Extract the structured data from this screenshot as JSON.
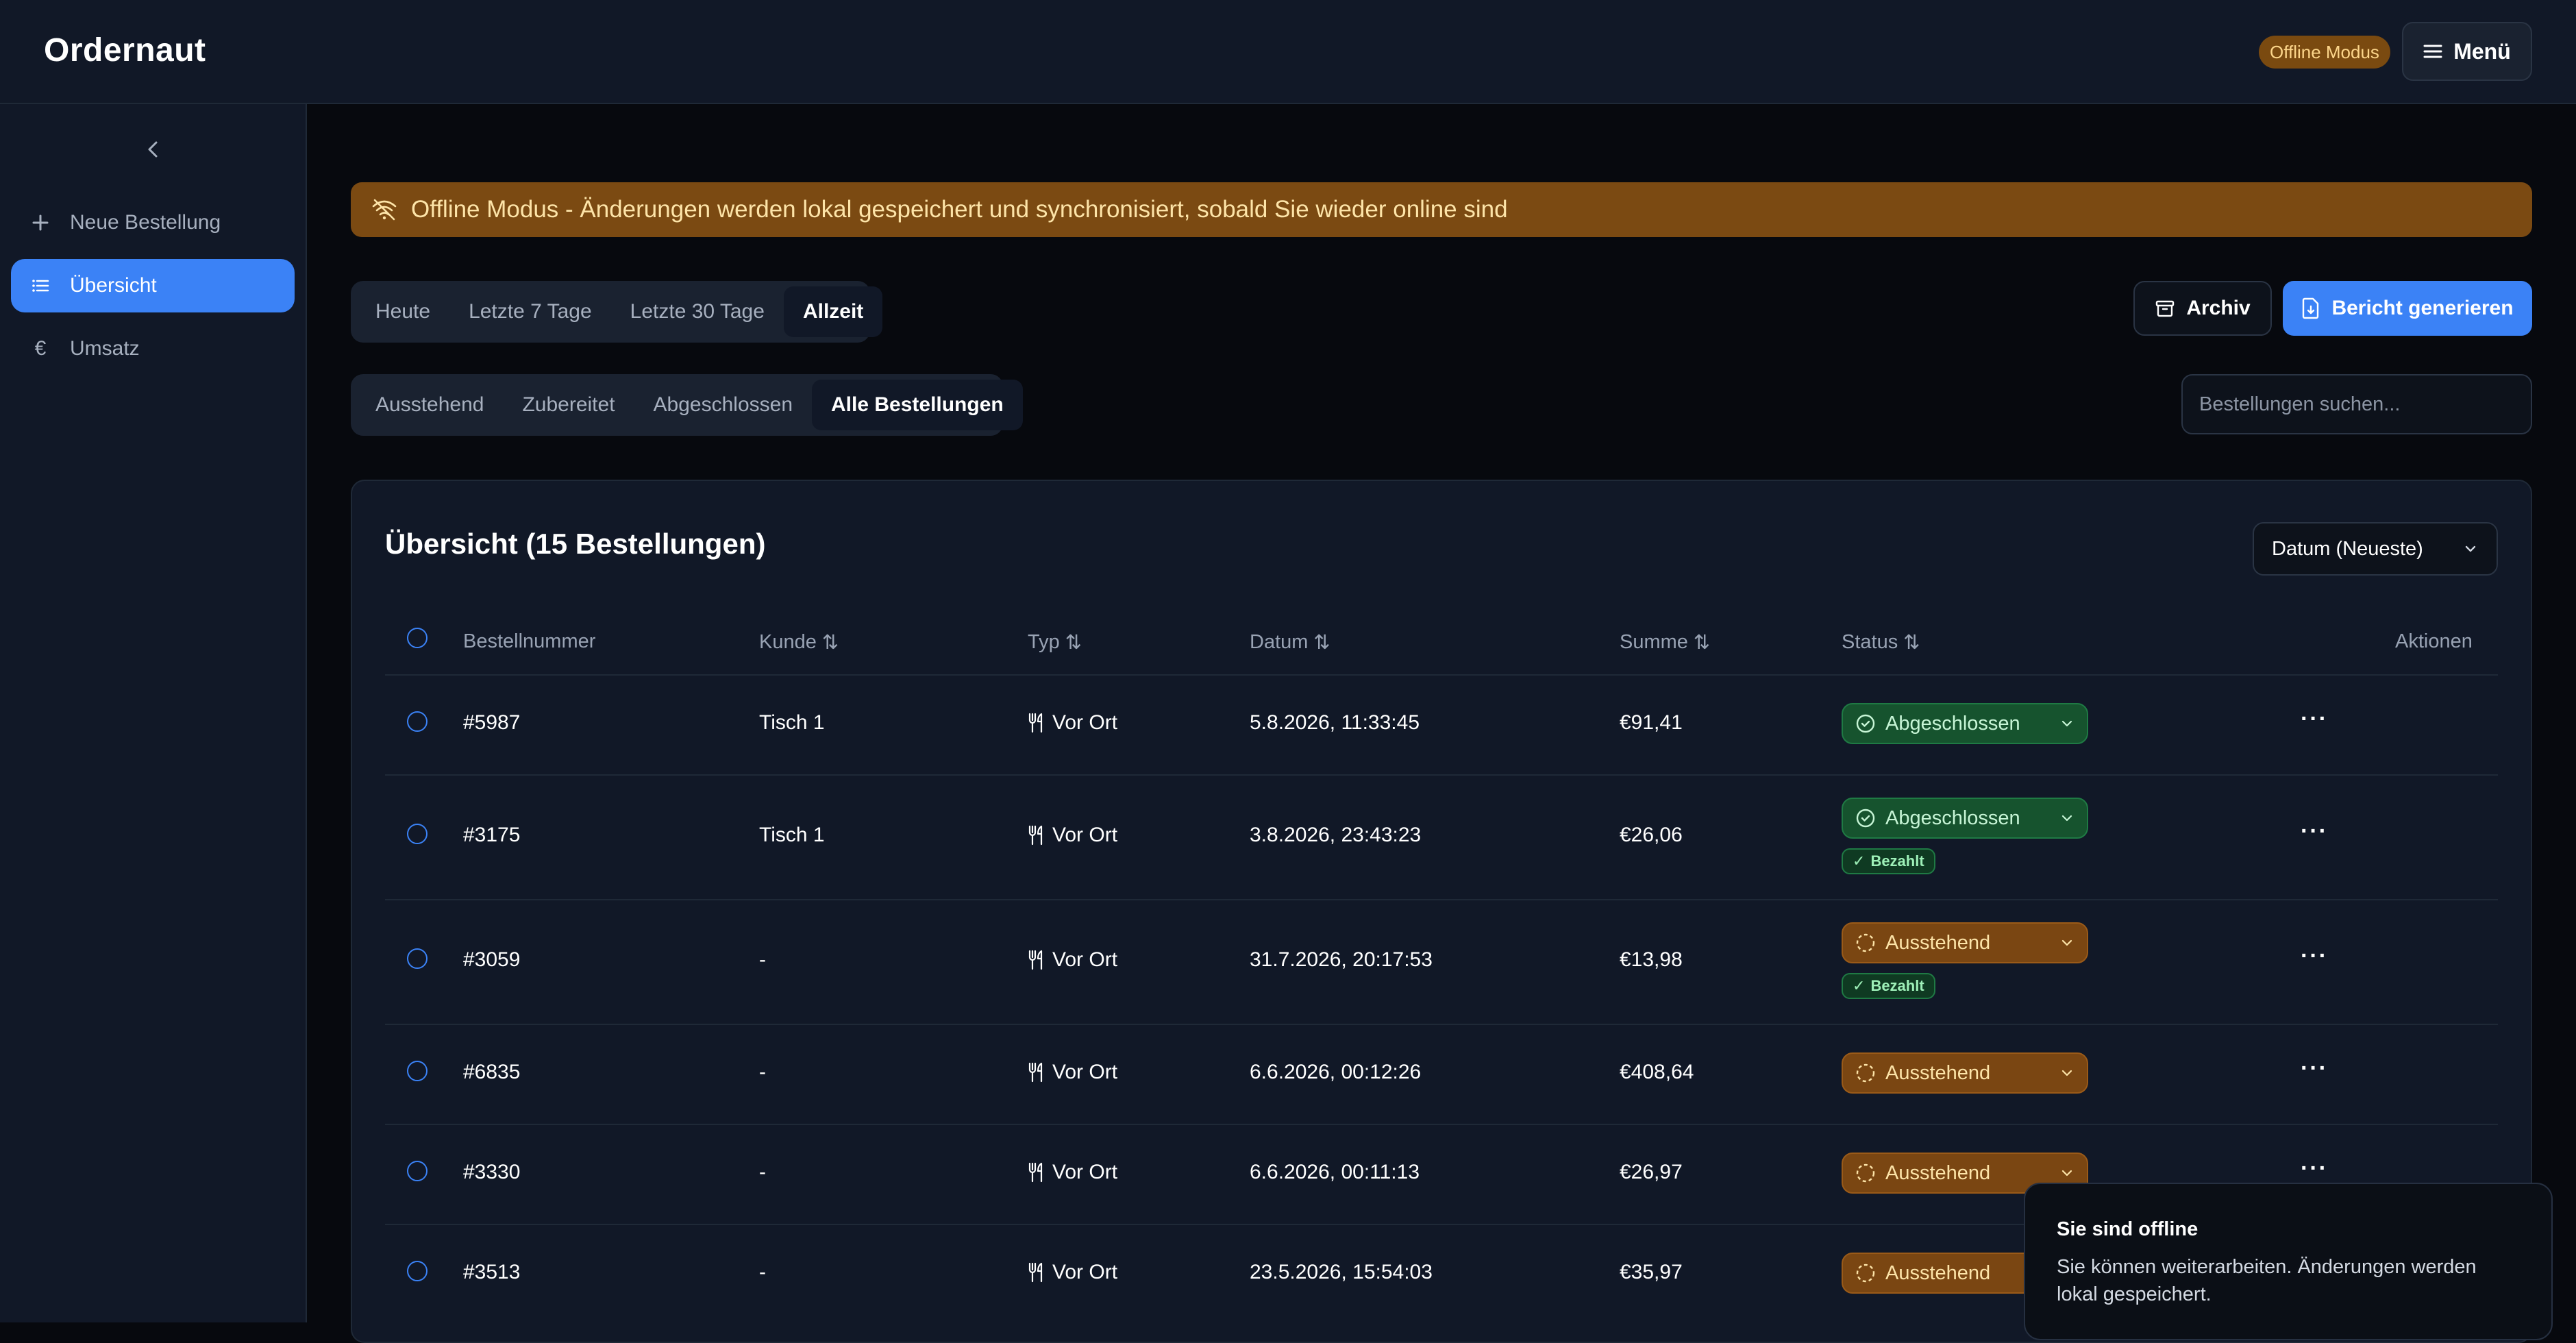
{
  "app": {
    "title": "Ordernaut",
    "offline_badge": "Offline Modus",
    "menu_label": "Menü"
  },
  "sidebar": {
    "items": [
      {
        "label": "Neue Bestellung",
        "icon": "plus-icon",
        "active": false
      },
      {
        "label": "Übersicht",
        "icon": "list-icon",
        "active": true
      },
      {
        "label": "Umsatz",
        "icon": "euro-icon",
        "active": false
      }
    ]
  },
  "banner": {
    "text": "Offline Modus - Änderungen werden lokal gespeichert und synchronisiert, sobald Sie wieder online sind"
  },
  "time_filters": {
    "tabs": [
      "Heute",
      "Letzte 7 Tage",
      "Letzte 30 Tage",
      "Allzeit"
    ],
    "active": "Allzeit"
  },
  "status_filters": {
    "tabs": [
      "Ausstehend",
      "Zubereitet",
      "Abgeschlossen",
      "Alle Bestellungen"
    ],
    "active": "Alle Bestellungen"
  },
  "actions": {
    "archive_label": "Archiv",
    "report_label": "Bericht generieren"
  },
  "search": {
    "placeholder": "Bestellungen suchen..."
  },
  "overview": {
    "title": "Übersicht (15 Bestellungen)",
    "sort_label": "Datum (Neueste)",
    "columns": {
      "order": "Bestellnummer",
      "customer": "Kunde",
      "type": "Typ",
      "date": "Datum",
      "total": "Summe",
      "status": "Status",
      "actions": "Aktionen"
    },
    "rows": [
      {
        "order": "#5987",
        "customer": "Tisch 1",
        "type": "Vor Ort",
        "date": "5.8.2026, 11:33:45",
        "total": "€91,41",
        "status": "Abgeschlossen",
        "paid": ""
      },
      {
        "order": "#3175",
        "customer": "Tisch 1",
        "type": "Vor Ort",
        "date": "3.8.2026, 23:43:23",
        "total": "€26,06",
        "status": "Abgeschlossen",
        "paid": "Bezahlt"
      },
      {
        "order": "#3059",
        "customer": "-",
        "type": "Vor Ort",
        "date": "31.7.2026, 20:17:53",
        "total": "€13,98",
        "status": "Ausstehend",
        "paid": "Bezahlt"
      },
      {
        "order": "#6835",
        "customer": "-",
        "type": "Vor Ort",
        "date": "6.6.2026, 00:12:26",
        "total": "€408,64",
        "status": "Ausstehend",
        "paid": ""
      },
      {
        "order": "#3330",
        "customer": "-",
        "type": "Vor Ort",
        "date": "6.6.2026, 00:11:13",
        "total": "€26,97",
        "status": "Ausstehend",
        "paid": ""
      },
      {
        "order": "#3513",
        "customer": "-",
        "type": "Vor Ort",
        "date": "23.5.2026, 15:54:03",
        "total": "€35,97",
        "status": "Ausstehend",
        "paid": ""
      }
    ]
  },
  "toast": {
    "title": "Sie sind offline",
    "body": "Sie können weiterarbeiten. Änderungen werden lokal gespeichert."
  },
  "colors": {
    "accent": "#3b82f6",
    "warning": "#7b4a12",
    "success": "#16532e",
    "background": "#07090e",
    "surface": "#111827"
  }
}
